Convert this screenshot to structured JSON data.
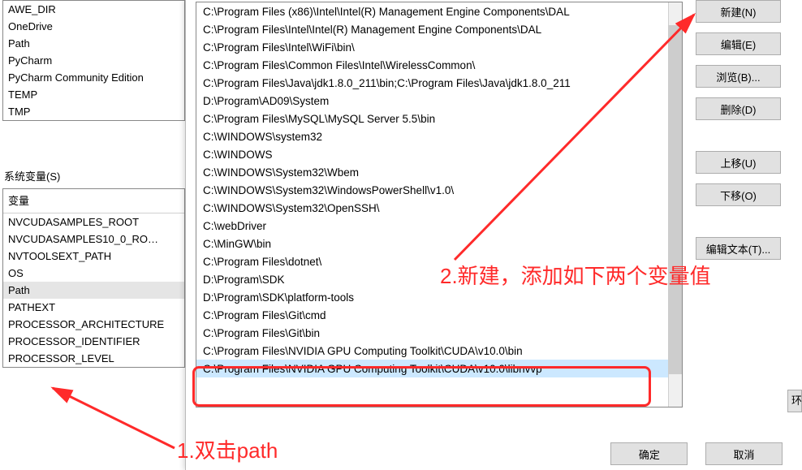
{
  "user_vars": {
    "items": [
      "AWE_DIR",
      "OneDrive",
      "Path",
      "PyCharm",
      "PyCharm Community Edition",
      "TEMP",
      "TMP"
    ]
  },
  "system_section_label": "系统变量(S)",
  "sys_vars": {
    "header": "变量",
    "items": [
      "NVCUDASAMPLES_ROOT",
      "NVCUDASAMPLES10_0_RO…",
      "NVTOOLSEXT_PATH",
      "OS",
      "Path",
      "PATHEXT",
      "PROCESSOR_ARCHITECTURE",
      "PROCESSOR_IDENTIFIER",
      "PROCESSOR_LEVEL"
    ],
    "selected_index": 4
  },
  "path_entries": [
    "C:\\Program Files (x86)\\Intel\\Intel(R) Management Engine Components\\DAL",
    "C:\\Program Files\\Intel\\Intel(R) Management Engine Components\\DAL",
    "C:\\Program Files\\Intel\\WiFi\\bin\\",
    "C:\\Program Files\\Common Files\\Intel\\WirelessCommon\\",
    "C:\\Program Files\\Java\\jdk1.8.0_211\\bin;C:\\Program Files\\Java\\jdk1.8.0_211",
    "D:\\Program\\AD09\\System",
    "C:\\Program Files\\MySQL\\MySQL Server 5.5\\bin",
    "C:\\WINDOWS\\system32",
    "C:\\WINDOWS",
    "C:\\WINDOWS\\System32\\Wbem",
    "C:\\WINDOWS\\System32\\WindowsPowerShell\\v1.0\\",
    "C:\\WINDOWS\\System32\\OpenSSH\\",
    "C:\\webDriver",
    "C:\\MinGW\\bin",
    "C:\\Program Files\\dotnet\\",
    "D:\\Program\\SDK",
    "D:\\Program\\SDK\\platform-tools",
    "C:\\Program Files\\Git\\cmd",
    "C:\\Program Files\\Git\\bin",
    "C:\\Program Files\\NVIDIA GPU Computing Toolkit\\CUDA\\v10.0\\bin",
    "C:\\Program Files\\NVIDIA GPU Computing Toolkit\\CUDA\\v10.0\\libnvvp"
  ],
  "buttons": {
    "new": "新建(N)",
    "edit": "编辑(E)",
    "browse": "浏览(B)...",
    "delete": "删除(D)",
    "move_up": "上移(U)",
    "move_down": "下移(O)",
    "edit_text": "编辑文本(T)...",
    "ok": "确定",
    "cancel": "取消",
    "edge": "环"
  },
  "annotations": {
    "step1": "1.双击path",
    "step2": "2.新建，添加如下两个变量值"
  }
}
